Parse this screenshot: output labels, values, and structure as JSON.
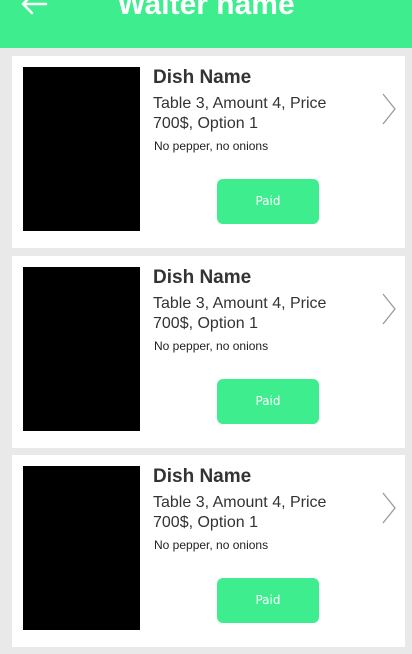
{
  "header": {
    "title": "Waiter name",
    "back_icon": "arrow-left-icon",
    "background": "#3ded8e"
  },
  "orders": [
    {
      "dish_name": "Dish Name",
      "details": "Table 3, Amount 4, Price 700$, Option 1",
      "note": "No pepper, no onions",
      "status_label": "Paid"
    },
    {
      "dish_name": "Dish Name",
      "details": "Table 3, Amount 4, Price 700$, Option 1",
      "note": "No pepper, no onions",
      "status_label": "Paid"
    },
    {
      "dish_name": "Dish Name",
      "details": "Table 3, Amount 4, Price 700$, Option 1",
      "note": "No pepper, no onions",
      "status_label": "Paid"
    }
  ],
  "colors": {
    "accent": "#3ded8e",
    "page_background": "#e9e9e9",
    "card_background": "#ffffff"
  },
  "icons": {
    "back": "arrow-left-icon",
    "open": "chevron-right-icon"
  }
}
